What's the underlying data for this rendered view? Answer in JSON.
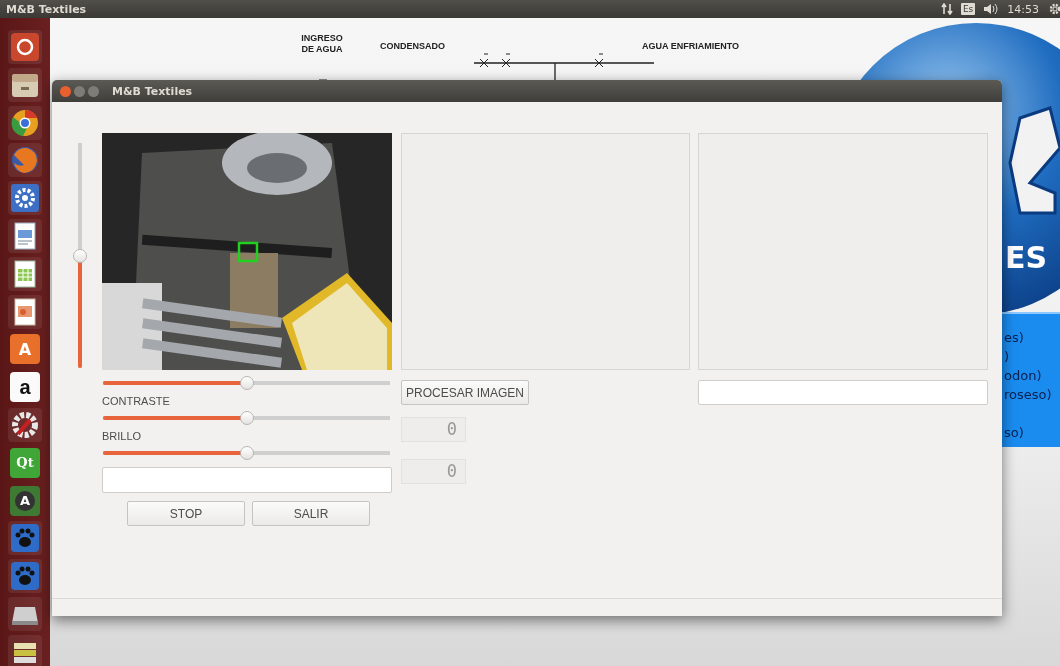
{
  "top_bar": {
    "title": "M&B Textiles",
    "keyboard": "Es",
    "time": "14:53"
  },
  "launcher": [
    {
      "kind": "dash"
    },
    {
      "kind": "files"
    },
    {
      "kind": "chrome"
    },
    {
      "kind": "firefox"
    },
    {
      "kind": "gear"
    },
    {
      "kind": "writer"
    },
    {
      "kind": "calc"
    },
    {
      "kind": "impress"
    },
    {
      "kind": "store",
      "label": "A"
    },
    {
      "kind": "amazon",
      "label": "a"
    },
    {
      "kind": "tools"
    },
    {
      "kind": "qt",
      "label": "Qt"
    },
    {
      "kind": "update",
      "label": "A"
    },
    {
      "kind": "paw"
    },
    {
      "kind": "paw"
    },
    {
      "kind": "drive"
    },
    {
      "kind": "stack"
    }
  ],
  "background_app": {
    "diagram_labels": [
      "INGRESO DE AGUA",
      "CONDENSADO",
      "AGUA ENFRIAMIENTO"
    ],
    "logo_text": "ES",
    "list_items": [
      "es)",
      ")",
      "odon)",
      "roseso)",
      "so)"
    ]
  },
  "window": {
    "title": "M&B Textiles",
    "vertical_slider": {
      "level": 0.5
    },
    "camera": {
      "kind": "picture"
    },
    "sliders": [
      {
        "level": 0.5
      },
      {
        "label": "CONTRASTE",
        "level": 0.5
      },
      {
        "label": "BRILLO",
        "level": 0.5
      }
    ],
    "buttons": [
      "STOP",
      "SALIR"
    ],
    "process_button": "PROCESAR IMAGEN",
    "displays": [
      "0",
      "0"
    ]
  }
}
